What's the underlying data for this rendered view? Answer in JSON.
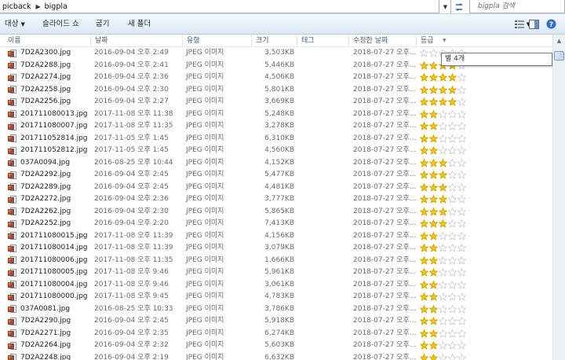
{
  "address": {
    "crumbs": [
      "picback",
      "bigpla"
    ],
    "search_placeholder": "bigpla 검색"
  },
  "toolbar": {
    "target_label": "대상",
    "slideshow_label": "슬라이드 쇼",
    "burn_label": "굽기",
    "new_folder_label": "새 폴더"
  },
  "columns": {
    "name": "이름",
    "date": "날짜",
    "type": "유형",
    "size": "크기",
    "tags": "태그",
    "modified": "수정한 날짜",
    "rating": "등급"
  },
  "tooltip": "별 4개",
  "colors": {
    "star_on": "#f2c618",
    "star_off": "#c9ccd1",
    "accent": "#2a5ea8"
  },
  "files": [
    {
      "name": "7D2A2300.jpg",
      "date": "2016-09-04 오후 2:49",
      "type": "JPEG 이미지",
      "size": "3,503KB",
      "modified": "2018-07-27 오후...",
      "rating": 0
    },
    {
      "name": "7D2A2288.jpg",
      "date": "2016-09-04 오후 2:41",
      "type": "JPEG 이미지",
      "size": "5,446KB",
      "modified": "2018-07-27 오후...",
      "rating": 4
    },
    {
      "name": "7D2A2274.jpg",
      "date": "2016-09-04 오후 2:36",
      "type": "JPEG 이미지",
      "size": "4,506KB",
      "modified": "2018-07-27 오후...",
      "rating": 4
    },
    {
      "name": "7D2A2258.jpg",
      "date": "2016-09-04 오후 2:30",
      "type": "JPEG 이미지",
      "size": "5,801KB",
      "modified": "2018-07-27 오후...",
      "rating": 4
    },
    {
      "name": "7D2A2256.jpg",
      "date": "2016-09-04 오후 2:27",
      "type": "JPEG 이미지",
      "size": "3,669KB",
      "modified": "2018-07-27 오후...",
      "rating": 4
    },
    {
      "name": "201711080013.jpg",
      "date": "2017-11-08 오후 11:38",
      "type": "JPEG 이미지",
      "size": "5,248KB",
      "modified": "2018-07-27 오후...",
      "rating": 2
    },
    {
      "name": "201711080007.jpg",
      "date": "2017-11-08 오후 11:35",
      "type": "JPEG 이미지",
      "size": "3,278KB",
      "modified": "2018-07-27 오후...",
      "rating": 2
    },
    {
      "name": "201711052814.jpg",
      "date": "2017-11-05 오후 1:45",
      "type": "JPEG 이미지",
      "size": "6,310KB",
      "modified": "2018-07-27 오후...",
      "rating": 2
    },
    {
      "name": "201711052812.jpg",
      "date": "2017-11-05 오후 1:45",
      "type": "JPEG 이미지",
      "size": "4,560KB",
      "modified": "2018-07-27 오후...",
      "rating": 2
    },
    {
      "name": "037A0094.jpg",
      "date": "2016-08-25 오후 10:44",
      "type": "JPEG 이미지",
      "size": "4,152KB",
      "modified": "2018-07-27 오후...",
      "rating": 3
    },
    {
      "name": "7D2A2292.jpg",
      "date": "2016-09-04 오후 2:45",
      "type": "JPEG 이미지",
      "size": "5,477KB",
      "modified": "2018-07-27 오후...",
      "rating": 3
    },
    {
      "name": "7D2A2289.jpg",
      "date": "2016-09-04 오후 2:45",
      "type": "JPEG 이미지",
      "size": "4,481KB",
      "modified": "2018-07-27 오후...",
      "rating": 3
    },
    {
      "name": "7D2A2272.jpg",
      "date": "2016-09-04 오후 2:36",
      "type": "JPEG 이미지",
      "size": "3,777KB",
      "modified": "2018-07-27 오후...",
      "rating": 3
    },
    {
      "name": "7D2A2262.jpg",
      "date": "2016-09-04 오후 2:30",
      "type": "JPEG 이미지",
      "size": "5,865KB",
      "modified": "2018-07-27 오후...",
      "rating": 3
    },
    {
      "name": "7D2A2252.jpg",
      "date": "2016-09-04 오후 2:20",
      "type": "JPEG 이미지",
      "size": "7,413KB",
      "modified": "2018-07-27 오후...",
      "rating": 3
    },
    {
      "name": "201711080015.jpg",
      "date": "2017-11-08 오후 11:39",
      "type": "JPEG 이미지",
      "size": "4,156KB",
      "modified": "2018-07-27 오후...",
      "rating": 2
    },
    {
      "name": "201711080014.jpg",
      "date": "2017-11-08 오후 11:39",
      "type": "JPEG 이미지",
      "size": "3,079KB",
      "modified": "2018-07-27 오후...",
      "rating": 2
    },
    {
      "name": "201711080006.jpg",
      "date": "2017-11-08 오후 11:35",
      "type": "JPEG 이미지",
      "size": "1,666KB",
      "modified": "2018-07-27 오후...",
      "rating": 2
    },
    {
      "name": "201711080005.jpg",
      "date": "2017-11-08 오후 9:46",
      "type": "JPEG 이미지",
      "size": "5,961KB",
      "modified": "2018-07-27 오후...",
      "rating": 2
    },
    {
      "name": "201711080004.jpg",
      "date": "2017-11-08 오후 9:46",
      "type": "JPEG 이미지",
      "size": "3,061KB",
      "modified": "2018-07-27 오후...",
      "rating": 2
    },
    {
      "name": "201711080000.jpg",
      "date": "2017-11-08 오후 9:45",
      "type": "JPEG 이미지",
      "size": "4,783KB",
      "modified": "2018-07-27 오후...",
      "rating": 2
    },
    {
      "name": "037A0081.jpg",
      "date": "2016-08-25 오후 10:33",
      "type": "JPEG 이미지",
      "size": "3,786KB",
      "modified": "2018-07-27 오후...",
      "rating": 2
    },
    {
      "name": "7D2A2290.jpg",
      "date": "2016-09-04 오후 2:45",
      "type": "JPEG 이미지",
      "size": "5,918KB",
      "modified": "2018-07-27 오후...",
      "rating": 2
    },
    {
      "name": "7D2A2271.jpg",
      "date": "2016-09-04 오후 2:35",
      "type": "JPEG 이미지",
      "size": "6,274KB",
      "modified": "2018-07-27 오후...",
      "rating": 2
    },
    {
      "name": "7D2A2264.jpg",
      "date": "2016-09-04 오후 2:32",
      "type": "JPEG 이미지",
      "size": "5,603KB",
      "modified": "2018-07-27 오후...",
      "rating": 2
    },
    {
      "name": "7D2A2248.jpg",
      "date": "2016-09-04 오후 2:19",
      "type": "JPEG 이미지",
      "size": "6,632KB",
      "modified": "2018-07-27 오후...",
      "rating": 2
    }
  ]
}
